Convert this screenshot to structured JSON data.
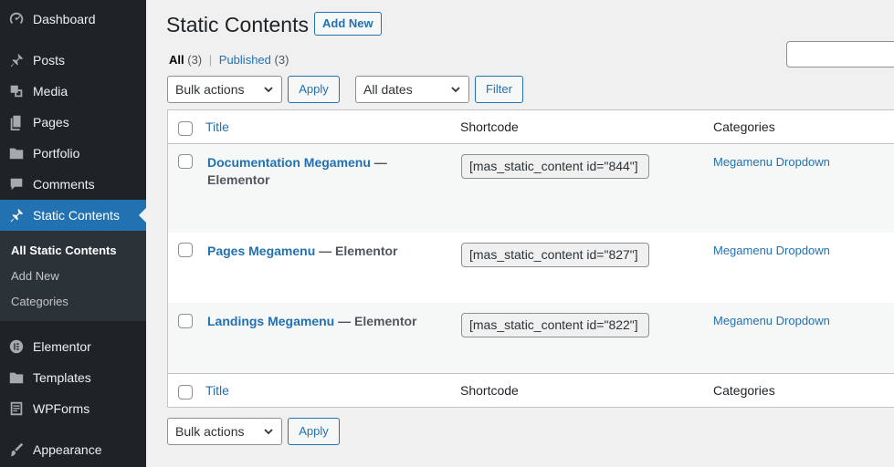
{
  "sidebar": {
    "items": [
      {
        "label": "Dashboard",
        "icon": "dashboard-icon"
      },
      {
        "label": "Posts",
        "icon": "pin-icon"
      },
      {
        "label": "Media",
        "icon": "media-icon"
      },
      {
        "label": "Pages",
        "icon": "pages-icon"
      },
      {
        "label": "Portfolio",
        "icon": "folder-icon"
      },
      {
        "label": "Comments",
        "icon": "comment-icon"
      },
      {
        "label": "Static Contents",
        "icon": "pin-icon"
      },
      {
        "label": "Elementor",
        "icon": "elementor-icon"
      },
      {
        "label": "Templates",
        "icon": "folder-icon"
      },
      {
        "label": "WPForms",
        "icon": "forms-icon"
      },
      {
        "label": "Appearance",
        "icon": "brush-icon"
      }
    ],
    "submenu": [
      "All Static Contents",
      "Add New",
      "Categories"
    ]
  },
  "header": {
    "title": "Static Contents",
    "add_new": "Add New"
  },
  "filters": {
    "all_label": "All",
    "all_count": "(3)",
    "separator": "|",
    "published_label": "Published",
    "published_count": "(3)"
  },
  "toolbar": {
    "bulk_actions": "Bulk actions",
    "apply": "Apply",
    "all_dates": "All dates",
    "filter": "Filter"
  },
  "table": {
    "columns": [
      "Title",
      "Shortcode",
      "Categories"
    ],
    "rows": [
      {
        "title": "Documentation Megamenu",
        "suffix": "— Elementor",
        "shortcode": "[mas_static_content id=\"844\"]",
        "category": "Megamenu Dropdown"
      },
      {
        "title": "Pages Megamenu",
        "suffix": "— Elementor",
        "shortcode": "[mas_static_content id=\"827\"]",
        "category": "Megamenu Dropdown"
      },
      {
        "title": "Landings Megamenu",
        "suffix": "— Elementor",
        "shortcode": "[mas_static_content id=\"822\"]",
        "category": "Megamenu Dropdown"
      }
    ]
  },
  "colors": {
    "sidebar_bg": "#1d2327",
    "accent": "#2271b1",
    "page_bg": "#f0f0f1"
  }
}
